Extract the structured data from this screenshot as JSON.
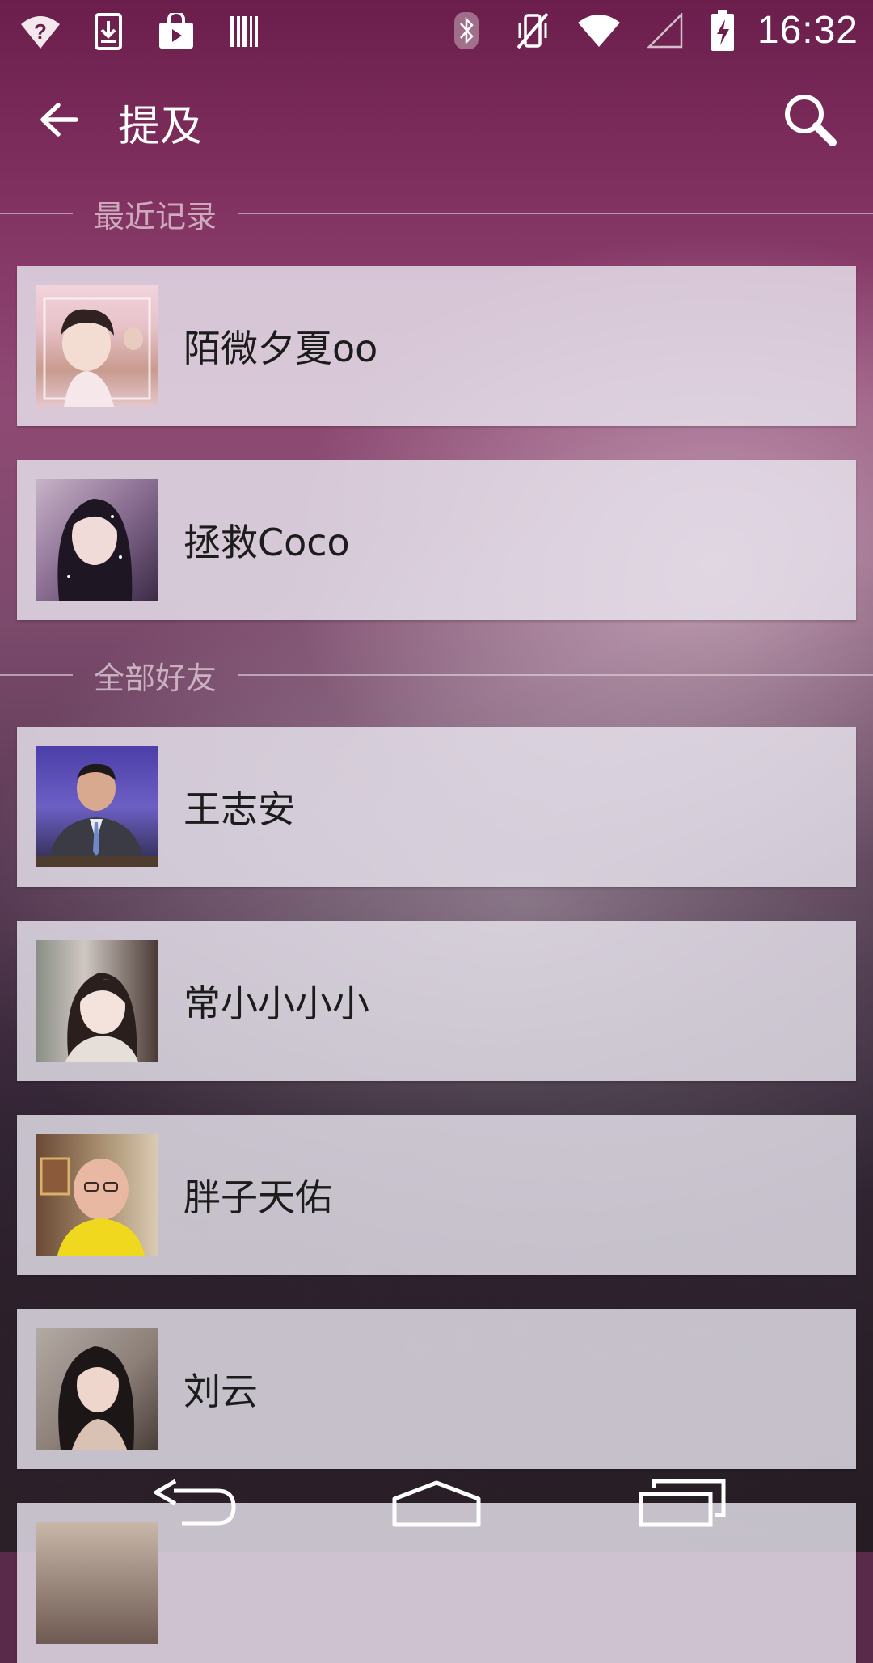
{
  "status_bar": {
    "time": "16:32",
    "left_icons": [
      "wifi-question-icon",
      "download-icon",
      "play-store-icon",
      "barcode-icon"
    ],
    "right_icons": [
      "bluetooth-icon",
      "vibrate-off-icon",
      "wifi-icon",
      "signal-icon",
      "battery-charging-icon"
    ]
  },
  "app_bar": {
    "title": "提及",
    "back_icon": "arrow-left-icon",
    "search_icon": "search-icon"
  },
  "sections": {
    "recent": {
      "label": "最近记录"
    },
    "all_friends": {
      "label": "全部好友"
    }
  },
  "recent_contacts": [
    {
      "name": "陌微夕夏oo",
      "avatar_colors": [
        "#e8c9d4",
        "#b98a78"
      ]
    },
    {
      "name": "拯救Coco",
      "avatar_colors": [
        "#9b7fa0",
        "#3a2a45"
      ]
    }
  ],
  "all_friends": [
    {
      "name": "王志安",
      "avatar_colors": [
        "#5b4fb0",
        "#2a2a3a"
      ]
    },
    {
      "name": "常小小小小",
      "avatar_colors": [
        "#cfc4c0",
        "#3a2e2a"
      ]
    },
    {
      "name": "胖子天佑",
      "avatar_colors": [
        "#b5976a",
        "#e9d13a"
      ]
    },
    {
      "name": "刘云",
      "avatar_colors": [
        "#9a8c84",
        "#2a2220"
      ]
    },
    {
      "name": "",
      "avatar_colors": [
        "#aa9a8a",
        "#443a36"
      ]
    }
  ],
  "nav_bar": {
    "back_icon": "nav-back-icon",
    "home_icon": "nav-home-icon",
    "recents_icon": "nav-recents-icon"
  }
}
